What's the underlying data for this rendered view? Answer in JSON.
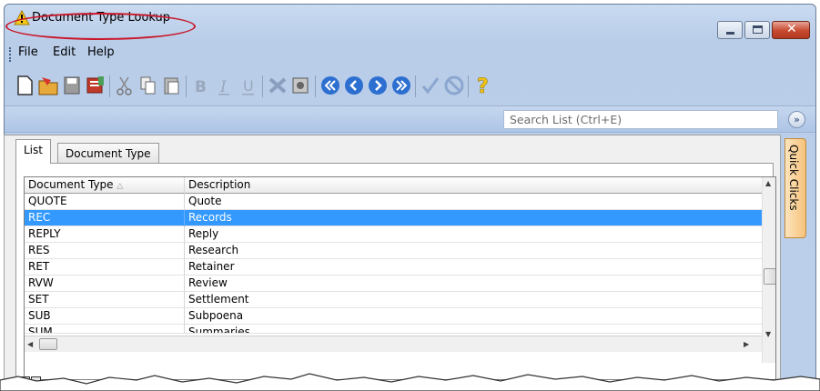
{
  "window": {
    "title": "Document Type Lookup"
  },
  "menu": [
    "File",
    "Edit",
    "Help"
  ],
  "toolbar": {
    "icons": [
      "new-document",
      "open-folder",
      "save",
      "save-notes",
      "cut",
      "copy",
      "paste",
      "bold",
      "italic",
      "underline",
      "delete",
      "image",
      "first",
      "previous",
      "next",
      "last",
      "check",
      "cancel",
      "help"
    ]
  },
  "search": {
    "placeholder": "Search List (Ctrl+E)"
  },
  "tabs": [
    "List",
    "Document Type"
  ],
  "grid": {
    "columns": [
      "Document Type",
      "Description"
    ],
    "rows": [
      [
        "QUOTE",
        "Quote"
      ],
      [
        "REC",
        "Records"
      ],
      [
        "REPLY",
        "Reply"
      ],
      [
        "RES",
        "Research"
      ],
      [
        "RET",
        "Retainer"
      ],
      [
        "RVW",
        "Review"
      ],
      [
        "SET",
        "Settlement"
      ],
      [
        "SUB",
        "Subpoena"
      ],
      [
        "SUM",
        "Summaries"
      ]
    ],
    "selected_index": 1
  },
  "quick_clicks": "Quick Clicks",
  "colors": {
    "selection": "#3399ff",
    "annotation": "#c9182b",
    "titlebar": "#c9daf0"
  }
}
